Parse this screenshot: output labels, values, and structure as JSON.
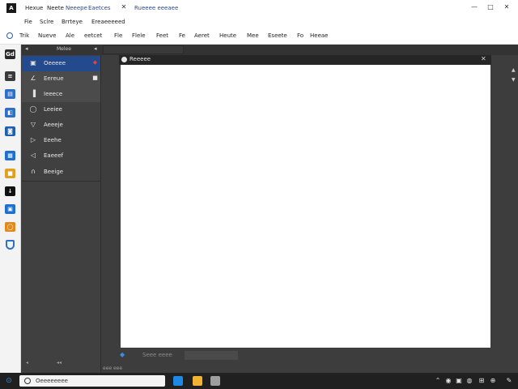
{
  "titlebar": {
    "app_icon": "app-logo-icon",
    "app_icon_glyph": "A",
    "tabs": [
      "Hexue",
      "Neete",
      "Neeepe",
      "Eaetces"
    ],
    "subtitle": "Rueeee eeeaee",
    "window_controls": [
      "—",
      "□",
      "✕"
    ]
  },
  "menubar": {
    "row1": [
      "Fie",
      "Sclre",
      "Brrteye",
      "Ereaeeeeed"
    ],
    "row2": [
      "Trik",
      "Nueve",
      "Ale",
      "eetcet",
      "Fle",
      "Flele",
      "Feet",
      "Fe",
      "Aeret",
      "Heute",
      "Mee",
      "Eseete",
      "Fo",
      "Heeae"
    ]
  },
  "strip": {
    "icons": [
      "calendar-icon",
      "document-icon",
      "browser-icon",
      "mail-icon",
      "phone-icon",
      "folder-icon",
      "terminal-icon",
      "shield-icon",
      "box-icon",
      "security-icon"
    ],
    "glyphs": [
      "Gd",
      "≡",
      "▤",
      "◧",
      "◙",
      "▦",
      "■",
      "↓",
      "▣",
      "◯"
    ]
  },
  "panel": {
    "title": "Melee",
    "arrow": "◂",
    "menu": "◂",
    "items": [
      {
        "label": "Oeeeee",
        "icon": "▣",
        "badge": "◆"
      },
      {
        "label": "Eereue",
        "icon": "∠",
        "badge": "■"
      },
      {
        "label": "Ieeece",
        "icon": "▐",
        "badge": ""
      },
      {
        "label": "Leeiee",
        "icon": "◯",
        "badge": ""
      },
      {
        "label": "Aeeeje",
        "icon": "▽",
        "badge": ""
      },
      {
        "label": "Eeehe",
        "icon": "▷",
        "badge": ""
      },
      {
        "label": "Eaeeef",
        "icon": "◁",
        "badge": ""
      },
      {
        "label": "Beeige",
        "icon": "∩",
        "badge": ""
      }
    ],
    "footer": [
      "◂",
      "◂◂",
      "eee eee"
    ]
  },
  "document": {
    "title": "Reeeee",
    "close": "✕"
  },
  "status": {
    "icon": "◆",
    "text": "Seee eeee"
  },
  "taskbar": {
    "start": "⊙",
    "search_text": "Oeeeeeeee",
    "apps": [
      "#1e88e5",
      "#f2b233",
      "#9e9e9e"
    ],
    "tray": [
      "⌃",
      "◉",
      "▣",
      "◍",
      "⊞",
      "⊕",
      "✎"
    ]
  },
  "colors": {
    "accent": "#234a8c",
    "workspace": "#3d3d3d",
    "canvas": "#ffffff"
  }
}
